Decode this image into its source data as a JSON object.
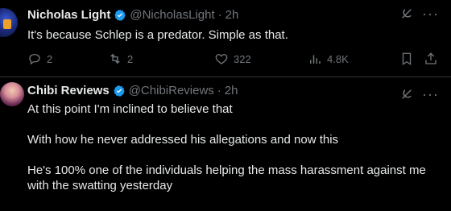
{
  "tweet1": {
    "name": "Nicholas Light",
    "handle": "@NicholasLight",
    "separator": "·",
    "time": "2h",
    "text": "It's because Schlep is a predator. Simple as that.",
    "replies": "2",
    "retweets": "2",
    "likes": "322",
    "views": "4.8K"
  },
  "tweet2": {
    "name": "Chibi Reviews",
    "handle": "@ChibiReviews",
    "separator": "·",
    "time": "2h",
    "text": "At this point I'm inclined to believe that\n\nWith how he never addressed his allegations and now this\n\nHe's 100% one of the individuals helping the mass harassment against me\nwith the swatting yesterday"
  },
  "icons": {
    "verified": "verified-badge-icon",
    "grok": "grok-icon",
    "more": "more-icon",
    "reply": "reply-icon",
    "retweet": "retweet-icon",
    "like": "heart-icon",
    "views": "views-icon",
    "bookmark": "bookmark-icon",
    "share": "share-icon"
  },
  "colors": {
    "background": "#000000",
    "text": "#e7e9ea",
    "secondary": "#71767b",
    "verified": "#1d9bf0"
  }
}
